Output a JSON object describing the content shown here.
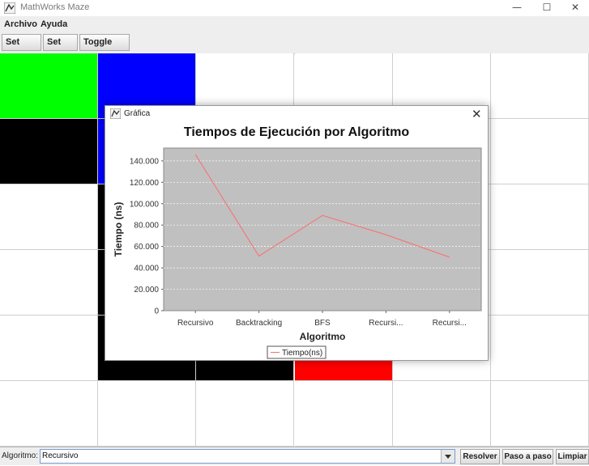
{
  "window": {
    "title": "MathWorks Maze",
    "controls": [
      "minimize-icon",
      "maximize-icon",
      "close-icon"
    ]
  },
  "menubar": {
    "items": [
      "Archivo",
      "Ayuda"
    ]
  },
  "toolbar": {
    "set_start": "Set Start",
    "set_end": "Set End",
    "toggle_wall": "Toggle Wall"
  },
  "maze": {
    "rows": 6,
    "cols": 6,
    "colors": {
      "start": "#00ff00",
      "end": "#ff0000",
      "wall": "#000000",
      "path": "#0000ff",
      "empty": "#ffffff"
    },
    "cells": [
      [
        "start",
        "path",
        "empty",
        "empty",
        "empty",
        "empty"
      ],
      [
        "wall",
        "path",
        "empty",
        "empty",
        "empty",
        "empty"
      ],
      [
        "empty",
        "wall",
        "empty",
        "empty",
        "empty",
        "empty"
      ],
      [
        "empty",
        "wall",
        "empty",
        "empty",
        "empty",
        "empty"
      ],
      [
        "empty",
        "wall",
        "wall",
        "end",
        "empty",
        "empty"
      ],
      [
        "empty",
        "empty",
        "empty",
        "empty",
        "empty",
        "empty"
      ]
    ]
  },
  "dialog": {
    "title": "Gráfica"
  },
  "chart_data": {
    "type": "line",
    "title": "Tiempos de Ejecución por Algoritmo",
    "xlabel": "Algoritmo",
    "ylabel": "Tiempo (ns)",
    "categories": [
      "Recursivo",
      "Backtracking",
      "BFS",
      "Recursi...",
      "Recursi..."
    ],
    "series": [
      {
        "name": "Tiempo(ns)",
        "color": "#ff6b6b",
        "values": [
          146000,
          51000,
          89000,
          71000,
          50000
        ]
      }
    ],
    "yticks": [
      "0",
      "20.000",
      "40.000",
      "60.000",
      "80.000",
      "100.000",
      "120.000",
      "140.000"
    ],
    "ylim": [
      0,
      152000
    ],
    "plot_background": "#c0c0c0",
    "grid": true,
    "legend_position": "bottom"
  },
  "bottombar": {
    "label": "Algoritmo:",
    "selected": "Recursivo",
    "resolver": "Resolver",
    "paso": "Paso a paso",
    "limpiar": "Limpiar"
  }
}
